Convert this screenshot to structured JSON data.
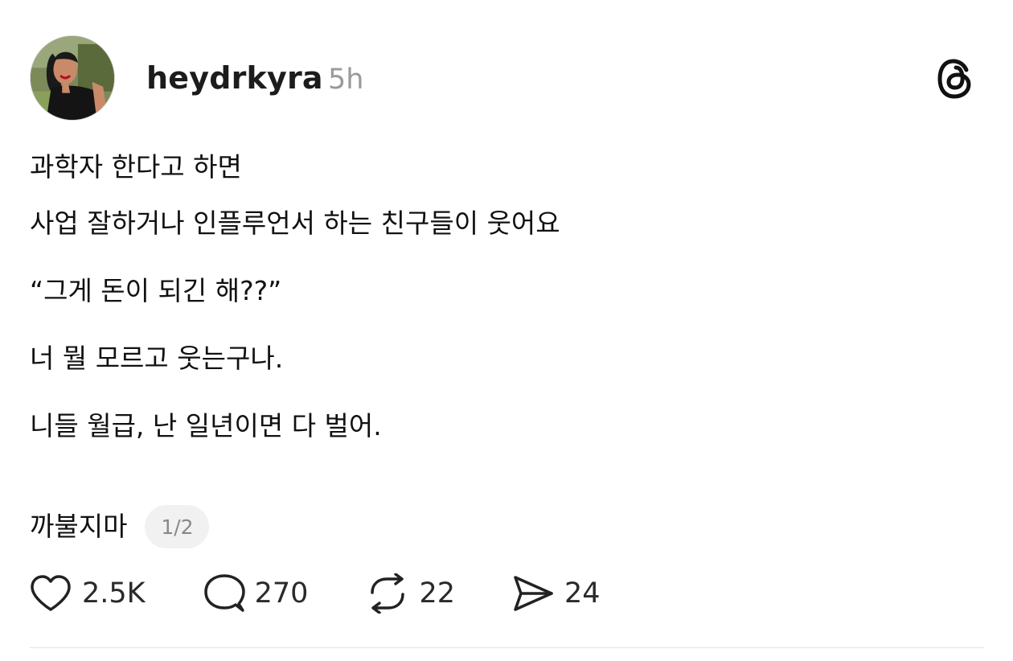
{
  "post": {
    "author": {
      "username": "heydrkyra",
      "time_ago": "5h"
    },
    "logo_icon": "threads-logo-icon",
    "body": {
      "line1": "과학자 한다고 하면",
      "line2": "사업 잘하거나 인플루언서 하는 친구들이 웃어요",
      "line3": "“그게 돈이 되긴 해??”",
      "line4": "너 뭘 모르고 웃는구나.",
      "line5": "니들 월급, 난 일년이면 다 벌어.",
      "line6": "까불지마"
    },
    "page_indicator": "1/2",
    "actions": {
      "likes": {
        "icon": "heart-icon",
        "count": "2.5K"
      },
      "replies": {
        "icon": "comment-bubble-icon",
        "count": "270"
      },
      "reposts": {
        "icon": "repost-icon",
        "count": "22"
      },
      "shares": {
        "icon": "send-icon",
        "count": "24"
      }
    }
  }
}
